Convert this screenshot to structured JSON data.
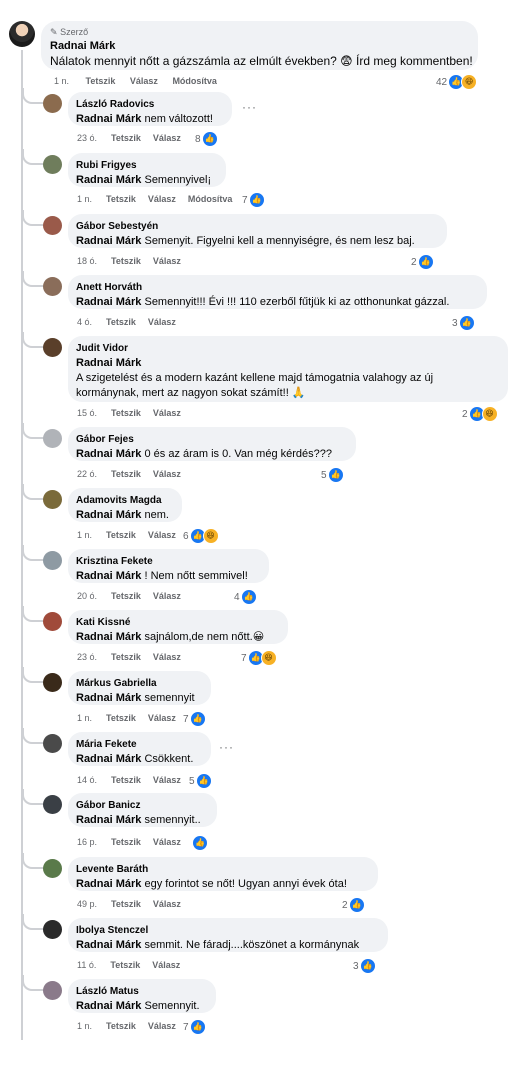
{
  "post": {
    "author_badge": "Szerző",
    "author": "Radnai Márk",
    "text": "Nálatok mennyit nőtt a gázszámla az elmúlt években? 😨 Írd meg kommentben!",
    "time": "1 n.",
    "like": "Tetszik",
    "reply": "Válasz",
    "edited": "Módosítva",
    "reactions": "42"
  },
  "mention": "Radnai Márk",
  "comments": [
    {
      "name": "László Radovics",
      "text": " nem változott!",
      "time": "23 ó.",
      "like": "Tetszik",
      "reply": "Válasz",
      "edited": "",
      "reactions": "8",
      "avatar": "#8b6b4e"
    },
    {
      "name": "Rubi Frigyes",
      "text": " Semennyivel¡",
      "time": "1 n.",
      "like": "Tetszik",
      "reply": "Válasz",
      "edited": "Módosítva",
      "reactions": "7",
      "avatar": "#6f7d5c"
    },
    {
      "name": "Gábor Sebestyén",
      "text": " Semenyit. Figyelni kell a mennyiségre, és nem lesz baj.",
      "time": "18 ó.",
      "like": "Tetszik",
      "reply": "Válasz",
      "edited": "",
      "reactions": "2",
      "avatar": "#9a5a4a"
    },
    {
      "name": "Anett Horváth",
      "text": " Semennyit!!! Évi !!! 110 ezerből fűtjük ki az otthonunkat gázzal.",
      "time": "4 ó.",
      "like": "Tetszik",
      "reply": "Válasz",
      "edited": "",
      "reactions": "3",
      "avatar": "#8a6d5a"
    },
    {
      "name": "Judit Vidor",
      "text_line1": "A szigetelést és a modern kazánt kellene majd támogatnia valahogy az új",
      "text_line2": "kormánynak, mert az nagyon sokat számít!! 🙏",
      "time": "15 ó.",
      "like": "Tetszik",
      "reply": "Válasz",
      "edited": "",
      "reactions": "2",
      "avatar": "#5a3f2a"
    },
    {
      "name": "Gábor Fejes",
      "text": " 0 és az áram is 0. Van még kérdés???",
      "time": "22 ó.",
      "like": "Tetszik",
      "reply": "Válasz",
      "edited": "",
      "reactions": "5",
      "avatar": "#b0b3b8"
    },
    {
      "name": "Adamovits Magda",
      "text": " nem.",
      "time": "1 n.",
      "like": "Tetszik",
      "reply": "Válasz",
      "edited": "",
      "reactions": "6",
      "avatar": "#7a6a3a"
    },
    {
      "name": "Krisztina Fekete",
      "text": " ! Nem nőtt semmivel!",
      "time": "20 ó.",
      "like": "Tetszik",
      "reply": "Válasz",
      "edited": "",
      "reactions": "4",
      "avatar": "#8e9aa3"
    },
    {
      "name": "Kati Kissné",
      "text": " sajnálom,de nem nőtt.😀",
      "time": "23 ó.",
      "like": "Tetszik",
      "reply": "Válasz",
      "edited": "",
      "reactions": "7",
      "avatar": "#a04a3a"
    },
    {
      "name": "Márkus Gabriella",
      "text": " semennyit",
      "time": "1 n.",
      "like": "Tetszik",
      "reply": "Válasz",
      "edited": "",
      "reactions": "7",
      "avatar": "#3a2a1a"
    },
    {
      "name": "Mária Fekete",
      "text": " Csökkent.",
      "time": "14 ó.",
      "like": "Tetszik",
      "reply": "Válasz",
      "edited": "",
      "reactions": "5",
      "avatar": "#4a4a4a"
    },
    {
      "name": "Gábor Banicz",
      "text": " semennyit..",
      "time": "16 p.",
      "like": "Tetszik",
      "reply": "Válasz",
      "edited": "",
      "reactions": "",
      "avatar": "#3a3f45"
    },
    {
      "name": "Levente Baráth",
      "text": " egy forintot se nőt! Ugyan annyi évek óta!",
      "time": "49 p.",
      "like": "Tetszik",
      "reply": "Válasz",
      "edited": "",
      "reactions": "2",
      "avatar": "#5a7a4a"
    },
    {
      "name": "Ibolya Stenczel",
      "text": " semmit. Ne fáradj....köszönet a kormánynak",
      "time": "11 ó.",
      "like": "Tetszik",
      "reply": "Válasz",
      "edited": "",
      "reactions": "3",
      "avatar": "#2a2a2a"
    },
    {
      "name": "László Matus",
      "text": " Semennyit.",
      "time": "1 n.",
      "like": "Tetszik",
      "reply": "Válasz",
      "edited": "",
      "reactions": "7",
      "avatar": "#8a7a8a"
    }
  ],
  "icons": {
    "like": "like-icon",
    "haha": "haha-icon",
    "more": "more-options-icon",
    "pencil": "pencil-icon"
  },
  "colors": {
    "bubble": "#f0f2f5",
    "like_blue": "#1877f2",
    "muted": "#65676b"
  }
}
